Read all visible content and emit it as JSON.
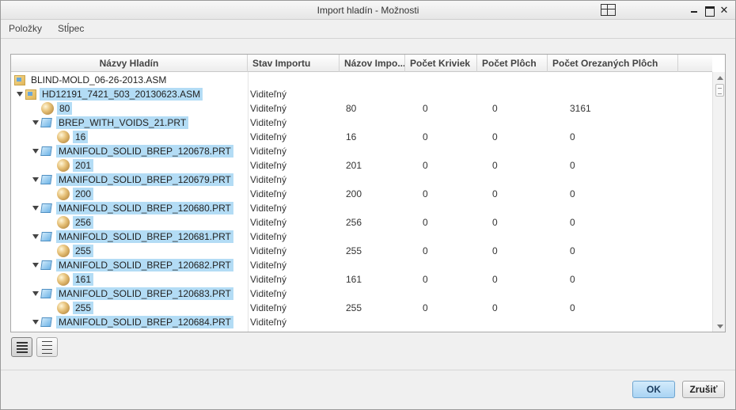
{
  "window": {
    "title": "Import hladín - Možnosti"
  },
  "menu": {
    "items": [
      "Položky",
      "Stĺpec"
    ]
  },
  "columns": [
    "Názvy Hladín",
    "Stav Importu",
    "Názov Impo...",
    "Počet Kriviek",
    "Počet Plôch",
    "Počet Orezaných Plôch"
  ],
  "rows": [
    {
      "kind": "asm",
      "depth": 0,
      "expanded": null,
      "name": "BLIND-MOLD_06-26-2013.ASM",
      "selected": false,
      "status": "",
      "import_name": "",
      "curves": "",
      "surfaces": "",
      "trimmed": ""
    },
    {
      "kind": "asm",
      "depth": 0,
      "expanded": true,
      "name": "HD12191_7421_503_20130623.ASM",
      "selected": true,
      "status": "Viditeľný",
      "import_name": "",
      "curves": "",
      "surfaces": "",
      "trimmed": ""
    },
    {
      "kind": "layer",
      "depth": 1,
      "expanded": null,
      "name": "80",
      "selected": true,
      "status": "Viditeľný",
      "import_name": "80",
      "curves": "0",
      "surfaces": "0",
      "trimmed": "3161"
    },
    {
      "kind": "part",
      "depth": 1,
      "expanded": true,
      "name": "BREP_WITH_VOIDS_21.PRT",
      "selected": true,
      "status": "Viditeľný",
      "import_name": "",
      "curves": "",
      "surfaces": "",
      "trimmed": ""
    },
    {
      "kind": "layer",
      "depth": 2,
      "expanded": null,
      "name": "16",
      "selected": true,
      "status": "Viditeľný",
      "import_name": "16",
      "curves": "0",
      "surfaces": "0",
      "trimmed": "0"
    },
    {
      "kind": "part",
      "depth": 1,
      "expanded": true,
      "name": "MANIFOLD_SOLID_BREP_120678.PRT",
      "selected": true,
      "status": "Viditeľný",
      "import_name": "",
      "curves": "",
      "surfaces": "",
      "trimmed": ""
    },
    {
      "kind": "layer",
      "depth": 2,
      "expanded": null,
      "name": "201",
      "selected": true,
      "status": "Viditeľný",
      "import_name": "201",
      "curves": "0",
      "surfaces": "0",
      "trimmed": "0"
    },
    {
      "kind": "part",
      "depth": 1,
      "expanded": true,
      "name": "MANIFOLD_SOLID_BREP_120679.PRT",
      "selected": true,
      "status": "Viditeľný",
      "import_name": "",
      "curves": "",
      "surfaces": "",
      "trimmed": ""
    },
    {
      "kind": "layer",
      "depth": 2,
      "expanded": null,
      "name": "200",
      "selected": true,
      "status": "Viditeľný",
      "import_name": "200",
      "curves": "0",
      "surfaces": "0",
      "trimmed": "0"
    },
    {
      "kind": "part",
      "depth": 1,
      "expanded": true,
      "name": "MANIFOLD_SOLID_BREP_120680.PRT",
      "selected": true,
      "status": "Viditeľný",
      "import_name": "",
      "curves": "",
      "surfaces": "",
      "trimmed": ""
    },
    {
      "kind": "layer",
      "depth": 2,
      "expanded": null,
      "name": "256",
      "selected": true,
      "status": "Viditeľný",
      "import_name": "256",
      "curves": "0",
      "surfaces": "0",
      "trimmed": "0"
    },
    {
      "kind": "part",
      "depth": 1,
      "expanded": true,
      "name": "MANIFOLD_SOLID_BREP_120681.PRT",
      "selected": true,
      "status": "Viditeľný",
      "import_name": "",
      "curves": "",
      "surfaces": "",
      "trimmed": ""
    },
    {
      "kind": "layer",
      "depth": 2,
      "expanded": null,
      "name": "255",
      "selected": true,
      "status": "Viditeľný",
      "import_name": "255",
      "curves": "0",
      "surfaces": "0",
      "trimmed": "0"
    },
    {
      "kind": "part",
      "depth": 1,
      "expanded": true,
      "name": "MANIFOLD_SOLID_BREP_120682.PRT",
      "selected": true,
      "status": "Viditeľný",
      "import_name": "",
      "curves": "",
      "surfaces": "",
      "trimmed": ""
    },
    {
      "kind": "layer",
      "depth": 2,
      "expanded": null,
      "name": "161",
      "selected": true,
      "status": "Viditeľný",
      "import_name": "161",
      "curves": "0",
      "surfaces": "0",
      "trimmed": "0"
    },
    {
      "kind": "part",
      "depth": 1,
      "expanded": true,
      "name": "MANIFOLD_SOLID_BREP_120683.PRT",
      "selected": true,
      "status": "Viditeľný",
      "import_name": "",
      "curves": "",
      "surfaces": "",
      "trimmed": ""
    },
    {
      "kind": "layer",
      "depth": 2,
      "expanded": null,
      "name": "255",
      "selected": true,
      "status": "Viditeľný",
      "import_name": "255",
      "curves": "0",
      "surfaces": "0",
      "trimmed": "0"
    },
    {
      "kind": "part",
      "depth": 1,
      "expanded": true,
      "name": "MANIFOLD_SOLID_BREP_120684.PRT",
      "selected": true,
      "status": "Viditeľný",
      "import_name": "",
      "curves": "",
      "surfaces": "",
      "trimmed": ""
    }
  ],
  "buttons": {
    "ok": "OK",
    "cancel": "Zrušiť"
  },
  "icons": {
    "window_layout": "layout-icon",
    "view_detailed": "list-detailed-icon",
    "view_compact": "list-compact-icon"
  },
  "colors": {
    "selection": "#b3dcf5",
    "ok_button": "#a9d3f3"
  }
}
